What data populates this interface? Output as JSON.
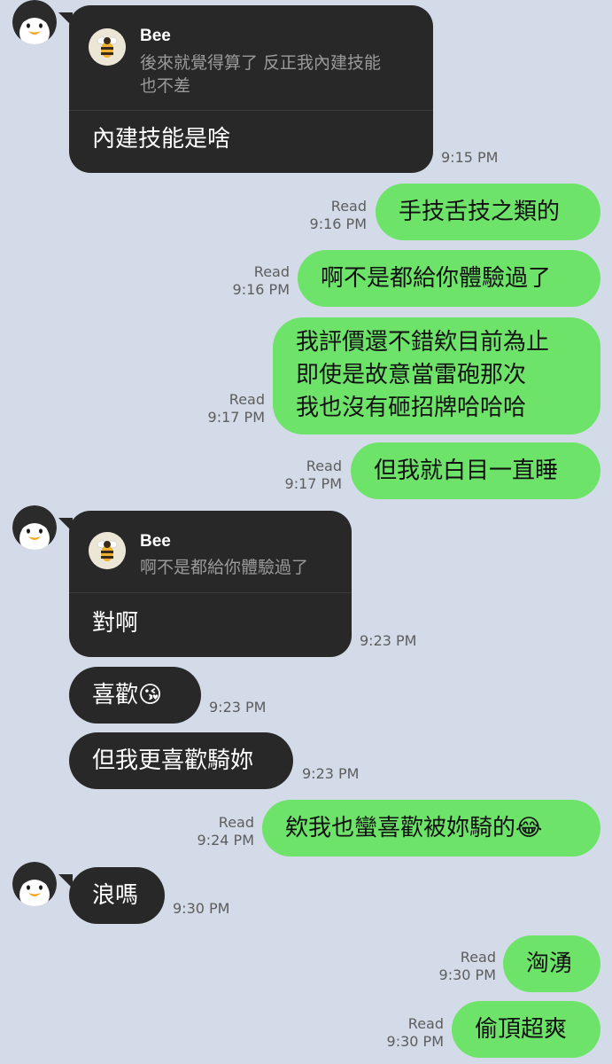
{
  "chat": {
    "messages": [
      {
        "id": 1,
        "direction": "in",
        "reply_to": {
          "name": "Bee",
          "quote": "後來就覺得算了 反正我內建技能也不差",
          "quote_lines": [
            "後來就覺得算了 反正我內建技能",
            "也不差"
          ]
        },
        "text": "內建技能是啥",
        "time": "9:15 PM"
      },
      {
        "id": 2,
        "direction": "out",
        "text": "手技舌技之類的",
        "status": "Read",
        "time": "9:16 PM"
      },
      {
        "id": 3,
        "direction": "out",
        "text": "啊不是都給你體驗過了",
        "status": "Read",
        "time": "9:16 PM"
      },
      {
        "id": 4,
        "direction": "out",
        "text_lines": [
          "我評價還不錯欸目前為止",
          "即使是故意當雷砲那次",
          "我也沒有砸招牌哈哈哈"
        ],
        "status": "Read",
        "time": "9:17 PM"
      },
      {
        "id": 5,
        "direction": "out",
        "text": "但我就白目一直睡",
        "status": "Read",
        "time": "9:17 PM"
      },
      {
        "id": 6,
        "direction": "in",
        "reply_to": {
          "name": "Bee",
          "quote": "啊不是都給你體驗過了"
        },
        "text": "對啊",
        "time": "9:23 PM"
      },
      {
        "id": 7,
        "direction": "in",
        "text": "喜歡",
        "emoji": "😘",
        "time": "9:23 PM"
      },
      {
        "id": 8,
        "direction": "in",
        "text": "但我更喜歡騎妳",
        "time": "9:23 PM"
      },
      {
        "id": 9,
        "direction": "out",
        "text": "欸我也蠻喜歡被妳騎的",
        "emoji": "😂",
        "status": "Read",
        "time": "9:24 PM"
      },
      {
        "id": 10,
        "direction": "in",
        "text": "浪嗎",
        "time": "9:30 PM"
      },
      {
        "id": 11,
        "direction": "out",
        "text": "洶湧",
        "status": "Read",
        "time": "9:30 PM"
      },
      {
        "id": 12,
        "direction": "out",
        "text": "偷頂超爽",
        "status": "Read",
        "time": "9:30 PM"
      }
    ]
  },
  "colors": {
    "background": "#d3dbe9",
    "incoming_bubble": "#282828",
    "outgoing_bubble": "#6ee36a",
    "meta_text": "#5d5d5d"
  },
  "icons": {
    "contact_avatar": "penguin-avatar-icon",
    "reply_avatar": "bee-icon"
  }
}
